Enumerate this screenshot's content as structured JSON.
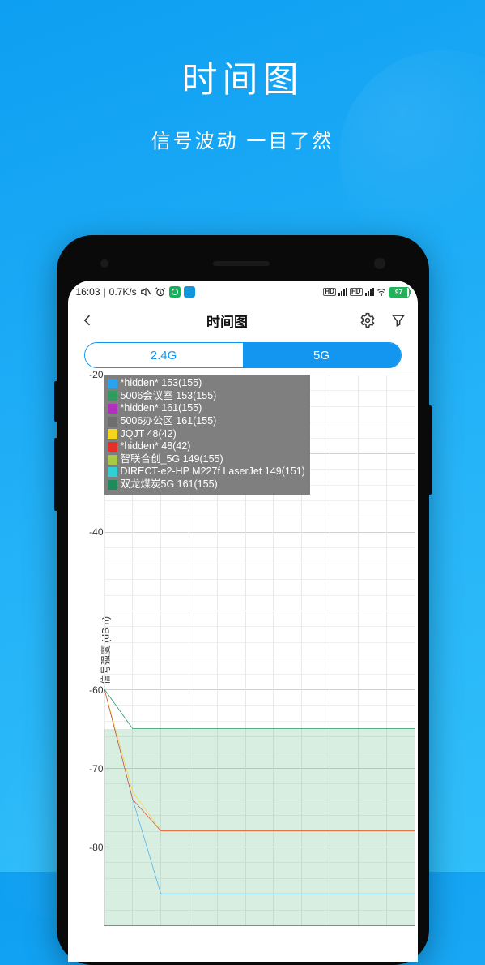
{
  "promo": {
    "title": "时间图",
    "subtitle": "信号波动 一目了然"
  },
  "statusbar": {
    "time": "16:03",
    "speed": "0.7K/s",
    "battery_pct": "97"
  },
  "header": {
    "title": "时间图"
  },
  "tabs": {
    "left": "2.4G",
    "right": "5G",
    "active": "right"
  },
  "chart_data": {
    "type": "line",
    "ylabel": "信号强度 (dBm)",
    "ylim": [
      -90,
      -20
    ],
    "yticks": [
      -20,
      -40,
      -60,
      -70,
      -80
    ],
    "legend": [
      {
        "color": "#2aa3ef",
        "label": "*hidden* 153(155)"
      },
      {
        "color": "#2e9c5c",
        "label": "5006会议室 153(155)"
      },
      {
        "color": "#b32fc2",
        "label": "*hidden* 161(155)"
      },
      {
        "color": "#6e6e6e",
        "label": "5006办公区 161(155)"
      },
      {
        "color": "#f4d61a",
        "label": "JQJT 48(42)"
      },
      {
        "color": "#e33129",
        "label": "*hidden* 48(42)"
      },
      {
        "color": "#a7c944",
        "label": "智联合创_5G 149(155)"
      },
      {
        "color": "#2fd0d4",
        "label": "DIRECT-e2-HP M227f LaserJet 149(151)"
      },
      {
        "color": "#1f8a5b",
        "label": "双龙煤炭5G 161(155)"
      }
    ],
    "x": [
      0,
      1,
      2,
      3,
      4,
      5,
      6,
      7,
      8,
      9,
      10,
      11
    ],
    "series": [
      {
        "name": "5006会议室 153(155)",
        "color": "#2e9c5c",
        "values": [
          -60,
          -65,
          -65,
          -65,
          -65,
          -65,
          -65,
          -65,
          -65,
          -65,
          -65,
          -65
        ]
      },
      {
        "name": "双龙煤炭5G 161(155)",
        "color": "#1f8a5b",
        "values": [
          -60,
          -65,
          -65,
          -65,
          -65,
          -65,
          -65,
          -65,
          -65,
          -65,
          -65,
          -65
        ]
      },
      {
        "name": "*hidden* 153(155)",
        "color": "#2aa3ef",
        "values": [
          -60,
          -74,
          -86,
          -86,
          -86,
          -86,
          -86,
          -86,
          -86,
          -86,
          -86,
          -86
        ]
      },
      {
        "name": "JQJT 48(42)",
        "color": "#f4d61a",
        "values": [
          -60,
          -73,
          -78,
          -78,
          -78,
          -78,
          -78,
          -78,
          -78,
          -78,
          -78,
          -78
        ]
      },
      {
        "name": "*hidden* 48(42)",
        "color": "#e33129",
        "values": [
          -60,
          -74,
          -78,
          -78,
          -78,
          -78,
          -78,
          -78,
          -78,
          -78,
          -78,
          -78
        ]
      }
    ],
    "fill_from": -65,
    "fill_to": -90
  }
}
